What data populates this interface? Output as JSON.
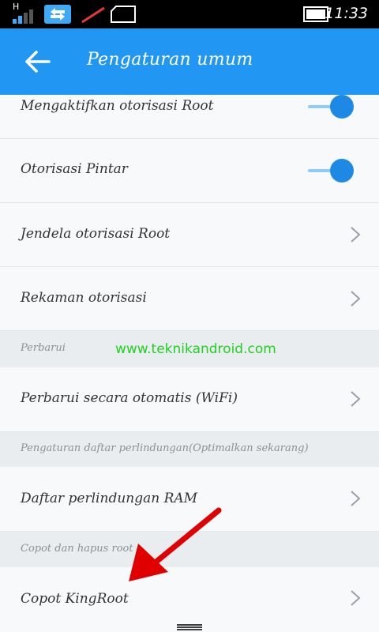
{
  "status_bar": {
    "signal_label": "H",
    "time": "11:33"
  },
  "header": {
    "title": "Pengaturan umum",
    "back_icon": "arrow-left-icon"
  },
  "rows": [
    {
      "label": "Mengaktifkan otorisasi Root",
      "control": "toggle",
      "on": true
    },
    {
      "label": "Otorisasi Pintar",
      "control": "toggle",
      "on": true
    },
    {
      "label": "Jendela otorisasi Root",
      "control": "chevron"
    },
    {
      "label": "Rekaman otorisasi",
      "control": "chevron"
    },
    {
      "section": "Perbarui"
    },
    {
      "label": "Perbarui secara otomatis (WiFi)",
      "control": "chevron"
    },
    {
      "section": "Pengaturan daftar perlindungan(Optimalkan sekarang)"
    },
    {
      "label": "Daftar perlindungan RAM",
      "control": "chevron"
    },
    {
      "section": "Copot dan hapus root"
    },
    {
      "label": "Copot KingRoot",
      "control": "chevron"
    }
  ],
  "watermark": "www.teknikandroid.com",
  "colors": {
    "accent": "#2196f3",
    "toggle_on": "#1e88e5",
    "watermark": "#1fd11f",
    "annotation_arrow": "#e00000"
  }
}
